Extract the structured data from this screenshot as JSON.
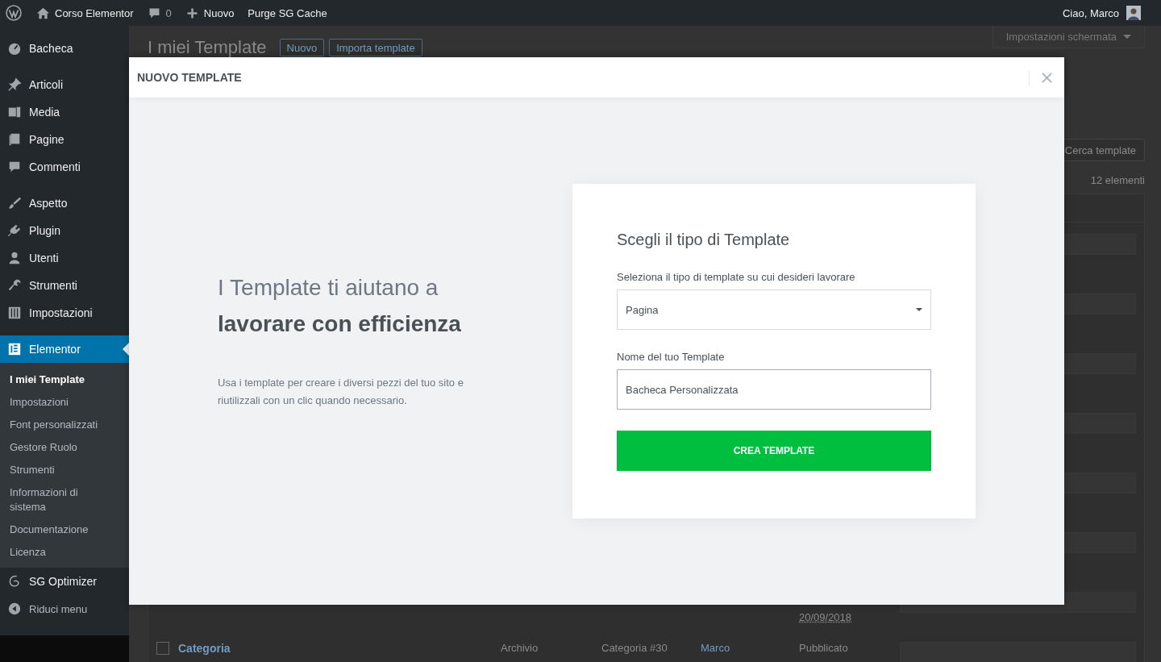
{
  "admin_bar": {
    "site": "Corso Elementor",
    "comments": "0",
    "new": "Nuovo",
    "purge": "Purge SG Cache",
    "greeting": "Ciao, Marco"
  },
  "sidebar": {
    "groups": [
      [
        {
          "label": "Bacheca",
          "selected": false
        }
      ],
      [
        {
          "label": "Articoli",
          "selected": false
        },
        {
          "label": "Media",
          "selected": false
        },
        {
          "label": "Pagine",
          "selected": false
        },
        {
          "label": "Commenti",
          "selected": false
        }
      ],
      [
        {
          "label": "Aspetto",
          "selected": false
        },
        {
          "label": "Plugin",
          "selected": false
        },
        {
          "label": "Utenti",
          "selected": false
        },
        {
          "label": "Strumenti",
          "selected": false
        },
        {
          "label": "Impostazioni",
          "selected": false
        }
      ],
      [
        {
          "label": "Elementor",
          "selected": true,
          "children": [
            {
              "label": "I miei Template",
              "selected": true
            },
            {
              "label": "Impostazioni",
              "selected": false
            },
            {
              "label": "Font personalizzati",
              "selected": false
            },
            {
              "label": "Gestore Ruolo",
              "selected": false
            },
            {
              "label": "Strumenti",
              "selected": false
            },
            {
              "label": "Informazioni di sistema",
              "selected": false
            },
            {
              "label": "Documentazione",
              "selected": false
            },
            {
              "label": "Licenza",
              "selected": false
            }
          ]
        },
        {
          "label": "SG Optimizer",
          "selected": false
        }
      ]
    ],
    "collapse": "Riduci menu"
  },
  "background_page": {
    "screen_options": "Impostazioni schermata",
    "title": "I miei Template",
    "buttons": [
      "Nuovo",
      "Importa template"
    ],
    "search_button": "Cerca template",
    "count": "12 elementi",
    "rows": [
      {
        "kind": "covered"
      },
      {
        "kind": "covered"
      },
      {
        "kind": "covered"
      },
      {
        "kind": "covered"
      },
      {
        "kind": "covered"
      },
      {
        "kind": "covered"
      },
      {
        "kind": "covered",
        "date": "20/09/2018"
      },
      {
        "kind": "full",
        "checked": false,
        "title": "Categoria",
        "type": "Archivio",
        "category": "Categoria #30",
        "author": "Marco",
        "status": "Pubblicato"
      }
    ]
  },
  "modal": {
    "title": "NUOVO TEMPLATE",
    "heading": "I Template ti aiutano a **lavorare con efficienza**",
    "text": "Usa i template per creare i diversi pezzi del tuo sito e riutilizzali con un clic quando necessario.",
    "card": {
      "title": "Scegli il tipo di Template",
      "select_label": "Seleziona il tipo di template su cui desideri lavorare",
      "select_value": "Pagina",
      "name_label": "Nome del tuo Template",
      "name_value": "Bacheca Personalizzata",
      "submit": "CREA TEMPLATE"
    }
  }
}
